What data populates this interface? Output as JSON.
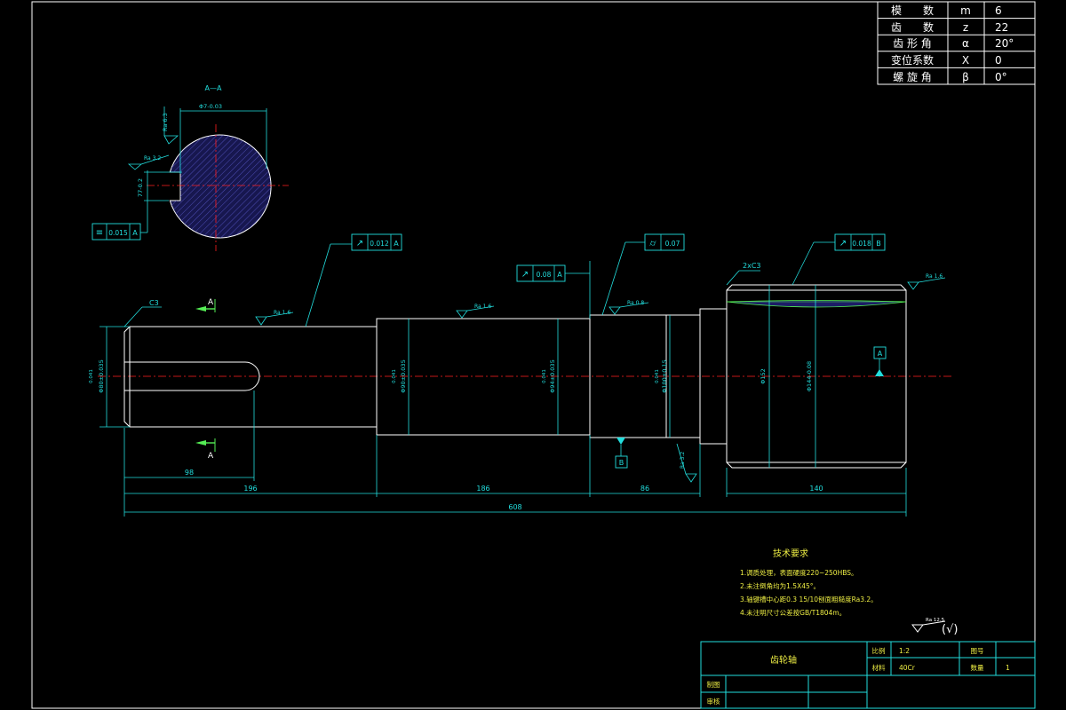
{
  "gear_params": {
    "rows": [
      {
        "name": "模　　数",
        "symbol": "m",
        "value": "6"
      },
      {
        "name": "齿　　数",
        "symbol": "z",
        "value": "22"
      },
      {
        "name": "齿 形 角",
        "symbol": "α",
        "value": "20°"
      },
      {
        "name": "变位系数",
        "symbol": "X",
        "value": "0"
      },
      {
        "name": "螺 旋 角",
        "symbol": "β",
        "value": "0°"
      }
    ]
  },
  "section_view": {
    "title": "A—A",
    "diameter": "Φ7-0.03",
    "key_depth": "77-0.2",
    "roughness_top": "Ra 6.3",
    "roughness_left": "Ra 3.2",
    "tolerance": {
      "symbol": "≡",
      "value": "0.015",
      "datum": "A"
    }
  },
  "main_view": {
    "gdt": [
      {
        "symbol": "↗",
        "value": "0.012",
        "datum": "A"
      },
      {
        "symbol": "↗",
        "value": "0.08",
        "datum": "A"
      },
      {
        "symbol": "⌭",
        "value": "0.07",
        "datum": ""
      },
      {
        "symbol": "↗",
        "value": "0.018",
        "datum": "B"
      }
    ],
    "chamfer_left": "C3",
    "chamfer_right": "2xC3",
    "section_mark": "A",
    "datum_a": "A",
    "datum_b": "B",
    "roughness": [
      "Ra 1.6",
      "Ra 1.6",
      "Ra 0.8",
      "Ra 1.6",
      "Ra 3.2"
    ],
    "diameters": [
      "Φ80±0.035",
      "Φ90±0.035",
      "Φ94±0.035",
      "Φ100+0.15",
      "Φ152",
      "Φ144-0.08"
    ],
    "diam_tol_marks": [
      "0.041",
      "0.041",
      "0.041",
      "0.041"
    ],
    "lengths": {
      "key": "98",
      "seg1": "196",
      "seg2": "186",
      "seg3": "86",
      "seg4": "140",
      "total": "608"
    }
  },
  "tech_requirements": {
    "title": "技术要求",
    "items": [
      "1.调质处理，表面硬度220~250HBS。",
      "2.未注倒角均为1.5X45°。",
      "3.轴键槽中心距0.3 15/10刨面粗糙度Ra3.2。",
      "4.未注明尺寸公差按GB/T1804m。"
    ]
  },
  "general_roughness": {
    "label": "Ra 12.5",
    "paren": "(√)"
  },
  "title_block": {
    "part_name": "齿轮轴",
    "ratio_label": "比例",
    "ratio_value": "1:2",
    "drawing_no_label": "图号",
    "material_label": "材料",
    "material_value": "40Cr",
    "quantity_label": "数量",
    "quantity_value": "1",
    "drawn_label": "制图",
    "checked_label": "审核"
  }
}
